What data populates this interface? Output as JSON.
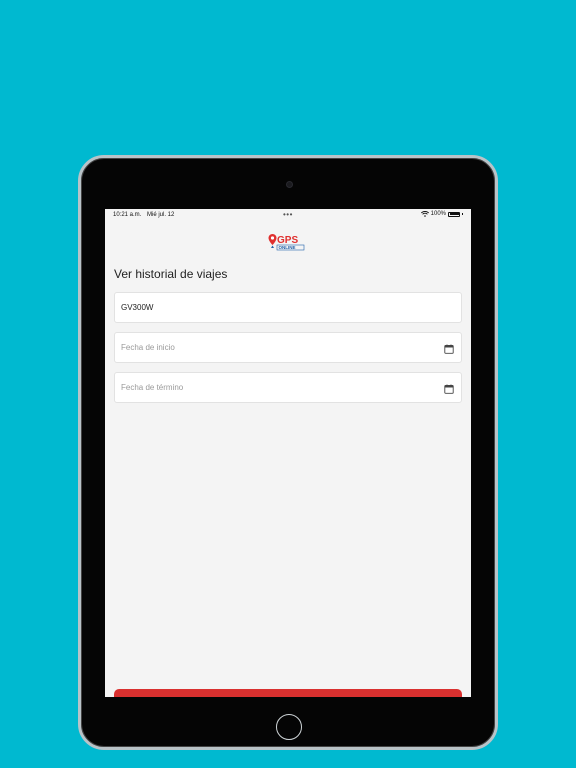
{
  "status_bar": {
    "time": "10:21 a.m.",
    "date": "Mié jul. 12",
    "dots": "•••",
    "battery": "100%"
  },
  "logo": {
    "main_text": "GPS",
    "sub_text": "ONLINE",
    "colors": {
      "red": "#e0302f",
      "blue": "#1f5fa8"
    }
  },
  "page": {
    "title": "Ver historial de viajes"
  },
  "form": {
    "vehicle_value": "GV300W",
    "start_date_placeholder": "Fecha de inicio",
    "end_date_placeholder": "Fecha de término"
  },
  "icons": {
    "start_date": "calendar-icon",
    "end_date": "calendar-icon"
  },
  "colors": {
    "background": "#00b9d0",
    "button": "#d9302f",
    "screen": "#f4f4f4"
  }
}
